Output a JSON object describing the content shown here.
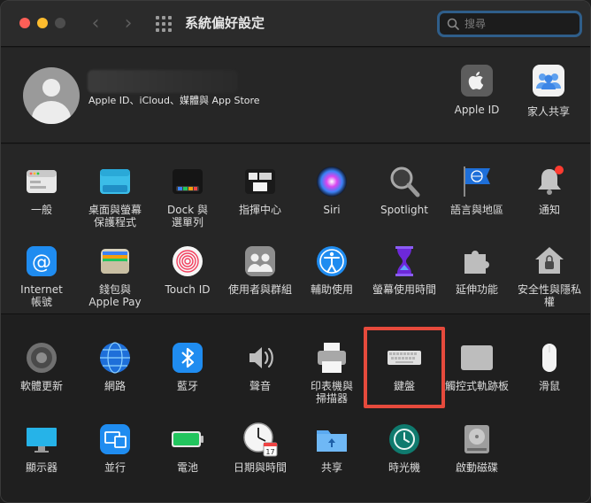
{
  "window": {
    "title": "系統偏好設定"
  },
  "search": {
    "placeholder": "搜尋"
  },
  "account": {
    "subtitle": "Apple ID、iCloud、媒體與 App Store",
    "apple_id_label": "Apple ID",
    "family_label": "家人共享"
  },
  "row1": [
    {
      "label": "一般"
    },
    {
      "label": "桌面與螢幕\n保護程式"
    },
    {
      "label": "Dock 與\n選單列"
    },
    {
      "label": "指揮中心"
    },
    {
      "label": "Siri"
    },
    {
      "label": "Spotlight"
    },
    {
      "label": "語言與地區"
    },
    {
      "label": "通知"
    }
  ],
  "row2": [
    {
      "label": "Internet\n帳號"
    },
    {
      "label": "錢包與\nApple Pay"
    },
    {
      "label": "Touch ID"
    },
    {
      "label": "使用者與群組"
    },
    {
      "label": "輔助使用"
    },
    {
      "label": "螢幕使用時間"
    },
    {
      "label": "延伸功能"
    },
    {
      "label": "安全性與隱私權"
    }
  ],
  "row3": [
    {
      "label": "軟體更新"
    },
    {
      "label": "網路"
    },
    {
      "label": "藍牙"
    },
    {
      "label": "聲音"
    },
    {
      "label": "印表機與\n掃描器"
    },
    {
      "label": "鍵盤"
    },
    {
      "label": "觸控式軌跡板"
    },
    {
      "label": "滑鼠"
    }
  ],
  "row4": [
    {
      "label": "顯示器"
    },
    {
      "label": "並行"
    },
    {
      "label": "電池"
    },
    {
      "label": "日期與時間",
      "calendar_day": "17"
    },
    {
      "label": "共享"
    },
    {
      "label": "時光機"
    },
    {
      "label": "啟動磁碟"
    }
  ],
  "colors": {
    "highlight": "#e64a3c",
    "search_ring": "#2f5e8a"
  }
}
